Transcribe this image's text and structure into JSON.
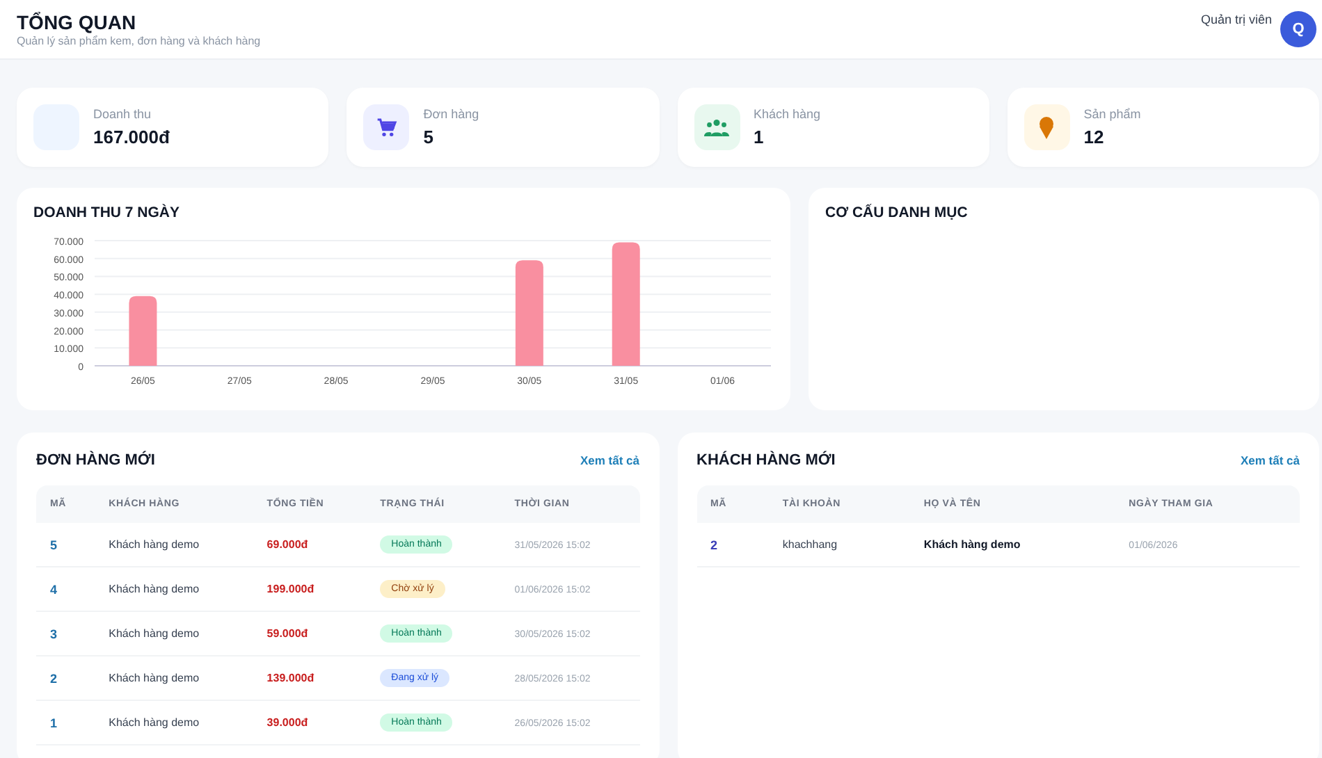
{
  "header": {
    "title": "TỔNG QUAN",
    "subtitle": "Quản lý sản phẩm kem, đơn hàng và khách hàng",
    "user_role": "Quản trị viên",
    "avatar_initial": "Q"
  },
  "stats": [
    {
      "kind": "revenue",
      "label": "Doanh thu",
      "value": "167.000đ"
    },
    {
      "kind": "orders",
      "label": "Đơn hàng",
      "value": "5"
    },
    {
      "kind": "customers",
      "label": "Khách hàng",
      "value": "1"
    },
    {
      "kind": "products",
      "label": "Sản phẩm",
      "value": "12"
    }
  ],
  "revenue_panel": {
    "title": "DOANH THU 7 NGÀY",
    "chart_data": {
      "type": "bar",
      "categories": [
        "26/05",
        "27/05",
        "28/05",
        "29/05",
        "30/05",
        "31/05",
        "01/06"
      ],
      "series": [
        {
          "color": "#f98fa0",
          "values": [
            39000,
            0,
            0,
            0,
            59000,
            69000,
            0
          ]
        }
      ],
      "grid": true,
      "ylim": [
        0,
        70000
      ],
      "yticks": [
        {
          "value": 0,
          "label": "0"
        },
        {
          "value": 10000,
          "label": "10.000"
        },
        {
          "value": 20000,
          "label": "20.000"
        },
        {
          "value": 30000,
          "label": "30.000"
        },
        {
          "value": 40000,
          "label": "40.000"
        },
        {
          "value": 50000,
          "label": "50.000"
        },
        {
          "value": 60000,
          "label": "60.000"
        },
        {
          "value": 70000,
          "label": "70.000"
        }
      ]
    }
  },
  "category_panel": {
    "title": "CƠ CẤU DANH MỤC"
  },
  "orders": {
    "title": "ĐƠN HÀNG MỚI",
    "link": "Xem tất cả",
    "columns": [
      "MÃ",
      "KHÁCH HÀNG",
      "TỔNG TIỀN",
      "TRẠNG THÁI",
      "THỜI GIAN"
    ],
    "rows": [
      {
        "id": "5",
        "customer": "Khách hàng demo",
        "total": "69.000đ",
        "status": "Hoàn thành",
        "kind": "done",
        "time": "31/05/2026 15:02"
      },
      {
        "id": "4",
        "customer": "Khách hàng demo",
        "total": "199.000đ",
        "status": "Chờ xử lý",
        "kind": "pending",
        "time": "01/06/2026 15:02"
      },
      {
        "id": "3",
        "customer": "Khách hàng demo",
        "total": "59.000đ",
        "status": "Hoàn thành",
        "kind": "done",
        "time": "30/05/2026 15:02"
      },
      {
        "id": "2",
        "customer": "Khách hàng demo",
        "total": "139.000đ",
        "status": "Đang xử lý",
        "kind": "processing",
        "time": "28/05/2026 15:02"
      },
      {
        "id": "1",
        "customer": "Khách hàng demo",
        "total": "39.000đ",
        "status": "Hoàn thành",
        "kind": "done",
        "time": "26/05/2026 15:02"
      }
    ]
  },
  "customers": {
    "title": "KHÁCH HÀNG MỚI",
    "link": "Xem tất cả",
    "columns": [
      "MÃ",
      "TÀI KHOẢN",
      "HỌ VÀ TÊN",
      "NGÀY THAM GIA"
    ],
    "rows": [
      {
        "id": "2",
        "username": "khachhang",
        "name": "Khách hàng demo",
        "joined": "01/06/2026"
      }
    ]
  }
}
